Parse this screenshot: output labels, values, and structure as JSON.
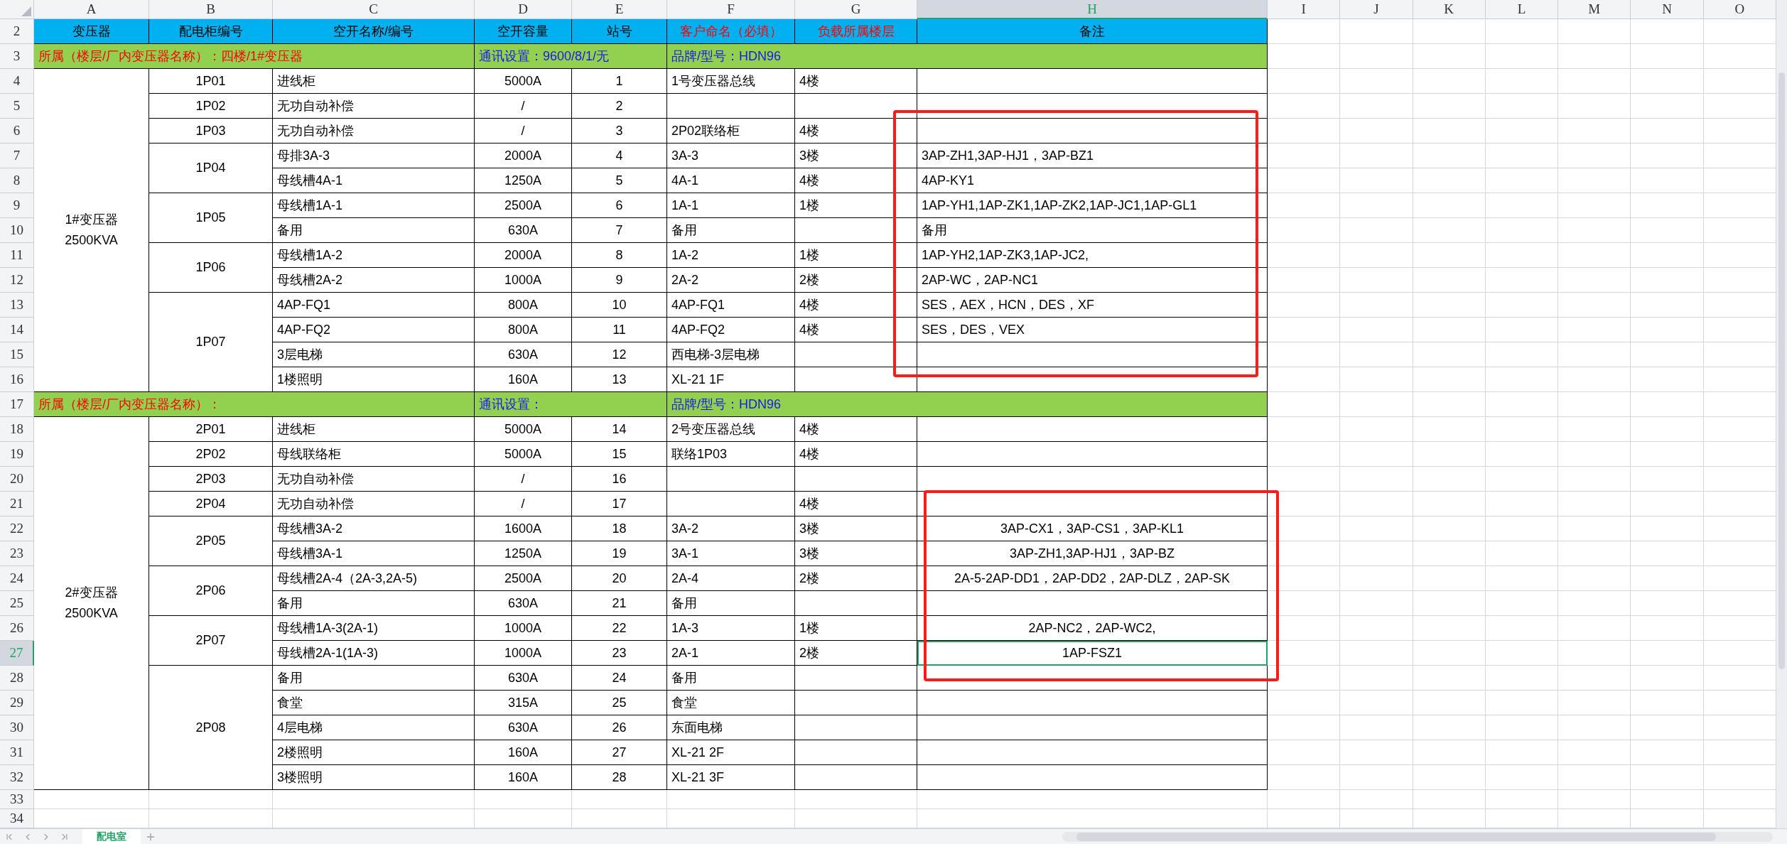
{
  "columns": [
    {
      "label": "A",
      "selected": false
    },
    {
      "label": "B",
      "selected": false
    },
    {
      "label": "C",
      "selected": false
    },
    {
      "label": "D",
      "selected": false
    },
    {
      "label": "E",
      "selected": false
    },
    {
      "label": "F",
      "selected": false
    },
    {
      "label": "G",
      "selected": false
    },
    {
      "label": "H",
      "selected": true
    },
    {
      "label": "I",
      "selected": false
    },
    {
      "label": "J",
      "selected": false
    },
    {
      "label": "K",
      "selected": false
    },
    {
      "label": "L",
      "selected": false
    },
    {
      "label": "M",
      "selected": false
    },
    {
      "label": "N",
      "selected": false
    },
    {
      "label": "O",
      "selected": false
    }
  ],
  "header_row": {
    "row": "2",
    "cells": [
      {
        "text": "变压器",
        "required": false
      },
      {
        "text": "配电柜编号",
        "required": false
      },
      {
        "text": "空开名称/编号",
        "required": false
      },
      {
        "text": "空开容量",
        "required": false
      },
      {
        "text": "站号",
        "required": false
      },
      {
        "text": "客户命名（必填）",
        "required": true
      },
      {
        "text": "负载所属楼层",
        "required": true
      },
      {
        "text": "备注",
        "required": false
      }
    ]
  },
  "sections": [
    {
      "info_row": {
        "row": "3",
        "location": "所属（楼层/厂内变压器名称）：四楼/1#变压器",
        "comm": "通讯设置：9600/8/1/无",
        "brand": "品牌/型号：HDN96"
      },
      "transformer": [
        "1#变压器",
        "2500KVA"
      ],
      "notes_centered": false,
      "cabinets": [
        {
          "id": "1P01",
          "circuits": [
            {
              "row": "4",
              "name": "进线柜",
              "capacity": "5000A",
              "station": "1",
              "customer_name": "1号变压器总线",
              "floor": "4楼",
              "selected": false
            }
          ]
        },
        {
          "id": "1P02",
          "circuits": [
            {
              "row": "5",
              "name": "无功自动补偿",
              "capacity": "/",
              "station": "2",
              "selected": false
            }
          ]
        },
        {
          "id": "1P03",
          "circuits": [
            {
              "row": "6",
              "name": "无功自动补偿",
              "capacity": "/",
              "station": "3",
              "customer_name": "2P02联络柜",
              "floor": "4楼",
              "selected": false
            }
          ]
        },
        {
          "id": "1P04",
          "circuits": [
            {
              "row": "7",
              "name": "母排3A-3",
              "capacity": "2000A",
              "station": "4",
              "customer_name": "3A-3",
              "floor": "3楼",
              "note": "3AP-ZH1,3AP-HJ1，3AP-BZ1",
              "selected": false
            },
            {
              "row": "8",
              "name": "母线槽4A-1",
              "capacity": "1250A",
              "station": "5",
              "customer_name": "4A-1",
              "floor": "4楼",
              "note": "4AP-KY1",
              "selected": false
            }
          ]
        },
        {
          "id": "1P05",
          "circuits": [
            {
              "row": "9",
              "name": "母线槽1A-1",
              "capacity": "2500A",
              "station": "6",
              "customer_name": "1A-1",
              "floor": "1楼",
              "note": "1AP-YH1,1AP-ZK1,1AP-ZK2,1AP-JC1,1AP-GL1",
              "selected": false
            },
            {
              "row": "10",
              "name": "备用",
              "capacity": "630A",
              "station": "7",
              "customer_name": "备用",
              "note": "备用",
              "selected": false
            }
          ]
        },
        {
          "id": "1P06",
          "circuits": [
            {
              "row": "11",
              "name": "母线槽1A-2",
              "capacity": "2000A",
              "station": "8",
              "customer_name": "1A-2",
              "floor": "1楼",
              "note": "1AP-YH2,1AP-ZK3,1AP-JC2,",
              "selected": false
            },
            {
              "row": "12",
              "name": "母线槽2A-2",
              "capacity": "1000A",
              "station": "9",
              "customer_name": "2A-2",
              "floor": "2楼",
              "note": "2AP-WC，2AP-NC1",
              "selected": false
            }
          ]
        },
        {
          "id": "1P07",
          "circuits": [
            {
              "row": "13",
              "name": "4AP-FQ1",
              "capacity": "800A",
              "station": "10",
              "customer_name": "4AP-FQ1",
              "floor": "4楼",
              "note": "SES，AEX，HCN，DES，XF",
              "selected": false
            },
            {
              "row": "14",
              "name": "4AP-FQ2",
              "capacity": "800A",
              "station": "11",
              "customer_name": "4AP-FQ2",
              "floor": "4楼",
              "note": "SES，DES，VEX",
              "selected": false
            },
            {
              "row": "15",
              "name": "3层电梯",
              "capacity": "630A",
              "station": "12",
              "customer_name": "西电梯-3层电梯",
              "selected": false
            },
            {
              "row": "16",
              "name": "1楼照明",
              "capacity": "160A",
              "station": "13",
              "customer_name": "XL-21 1F",
              "selected": false
            }
          ]
        }
      ]
    },
    {
      "info_row": {
        "row": "17",
        "location": "所属（楼层/厂内变压器名称）：",
        "comm": "通讯设置：",
        "brand": "品牌/型号：HDN96"
      },
      "transformer": [
        "2#变压器",
        "2500KVA"
      ],
      "notes_centered": true,
      "cabinets": [
        {
          "id": "2P01",
          "circuits": [
            {
              "row": "18",
              "name": "进线柜",
              "capacity": "5000A",
              "station": "14",
              "customer_name": "2号变压器总线",
              "floor": "4楼",
              "selected": false
            }
          ]
        },
        {
          "id": "2P02",
          "circuits": [
            {
              "row": "19",
              "name": "母线联络柜",
              "capacity": "5000A",
              "station": "15",
              "customer_name": "联络1P03",
              "floor": "4楼",
              "selected": false
            }
          ]
        },
        {
          "id": "2P03",
          "circuits": [
            {
              "row": "20",
              "name": "无功自动补偿",
              "capacity": "/",
              "station": "16",
              "selected": false
            }
          ]
        },
        {
          "id": "2P04",
          "circuits": [
            {
              "row": "21",
              "name": "无功自动补偿",
              "capacity": "/",
              "station": "17",
              "floor": "4楼",
              "selected": false
            }
          ]
        },
        {
          "id": "2P05",
          "circuits": [
            {
              "row": "22",
              "name": "母线槽3A-2",
              "capacity": "1600A",
              "station": "18",
              "customer_name": "3A-2",
              "floor": "3楼",
              "note": "3AP-CX1，3AP-CS1，3AP-KL1",
              "selected": false
            },
            {
              "row": "23",
              "name": "母线槽3A-1",
              "capacity": "1250A",
              "station": "19",
              "customer_name": "3A-1",
              "floor": "3楼",
              "note": "3AP-ZH1,3AP-HJ1，3AP-BZ",
              "selected": false
            }
          ]
        },
        {
          "id": "2P06",
          "circuits": [
            {
              "row": "24",
              "name": "母线槽2A-4（2A-3,2A-5)",
              "capacity": "2500A",
              "station": "20",
              "customer_name": "2A-4",
              "floor": "2楼",
              "note": "2A-5-2AP-DD1，2AP-DD2，2AP-DLZ，2AP-SK",
              "selected": false
            },
            {
              "row": "25",
              "name": "备用",
              "capacity": "630A",
              "station": "21",
              "customer_name": "备用",
              "selected": false
            }
          ]
        },
        {
          "id": "2P07",
          "circuits": [
            {
              "row": "26",
              "name": "母线槽1A-3(2A-1)",
              "capacity": "1000A",
              "station": "22",
              "customer_name": "1A-3",
              "floor": "1楼",
              "note": "2AP-NC2，2AP-WC2,",
              "selected": false
            },
            {
              "row": "27",
              "name": "母线槽2A-1(1A-3)",
              "capacity": "1000A",
              "station": "23",
              "customer_name": "2A-1",
              "floor": "2楼",
              "note": "1AP-FSZ1",
              "selected": true
            }
          ]
        },
        {
          "id": "2P08",
          "circuits": [
            {
              "row": "28",
              "name": "备用",
              "capacity": "630A",
              "station": "24",
              "customer_name": "备用",
              "selected": false
            },
            {
              "row": "29",
              "name": "食堂",
              "capacity": "315A",
              "station": "25",
              "customer_name": "食堂",
              "selected": false
            },
            {
              "row": "30",
              "name": "4层电梯",
              "capacity": "630A",
              "station": "26",
              "customer_name": "东面电梯",
              "selected": false
            },
            {
              "row": "31",
              "name": "2楼照明",
              "capacity": "160A",
              "station": "27",
              "customer_name": "XL-21 2F",
              "selected": false
            },
            {
              "row": "32",
              "name": "3楼照明",
              "capacity": "160A",
              "station": "28",
              "customer_name": "XL-21 3F",
              "selected": false
            }
          ]
        }
      ]
    }
  ],
  "empty_rows": [
    "33",
    "34"
  ],
  "annotations": [
    {
      "kind": "frame"
    },
    {
      "kind": "frame"
    }
  ],
  "sheet_tabs": [
    {
      "label": "配电室",
      "selected": true
    }
  ]
}
